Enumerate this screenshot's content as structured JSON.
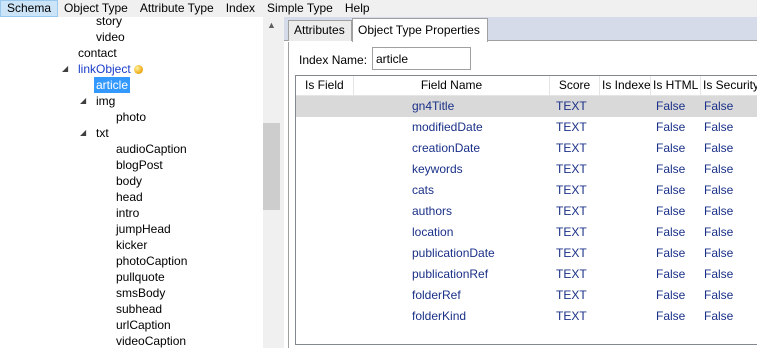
{
  "menu": [
    "Schema",
    "Object Type",
    "Attribute Type",
    "Index",
    "Simple Type",
    "Help"
  ],
  "tree": {
    "items": [
      {
        "label": "story",
        "level": 3,
        "toggle": "",
        "style": "normal"
      },
      {
        "label": "video",
        "level": 3,
        "toggle": "",
        "style": "normal"
      },
      {
        "label": "contact",
        "level": 2,
        "toggle": "",
        "style": "normal"
      },
      {
        "label": "linkObject",
        "level": 2,
        "toggle": "◢",
        "style": "blue",
        "badge": true
      },
      {
        "label": "article",
        "level": 3,
        "toggle": "",
        "style": "selected"
      },
      {
        "label": "img",
        "level": 3,
        "toggle": "◢",
        "style": "normal"
      },
      {
        "label": "photo",
        "level": 4,
        "toggle": "",
        "style": "normal"
      },
      {
        "label": "txt",
        "level": 3,
        "toggle": "◢",
        "style": "normal"
      },
      {
        "label": "audioCaption",
        "level": 4,
        "toggle": "",
        "style": "normal"
      },
      {
        "label": "blogPost",
        "level": 4,
        "toggle": "",
        "style": "normal"
      },
      {
        "label": "body",
        "level": 4,
        "toggle": "",
        "style": "normal"
      },
      {
        "label": "head",
        "level": 4,
        "toggle": "",
        "style": "normal"
      },
      {
        "label": "intro",
        "level": 4,
        "toggle": "",
        "style": "normal"
      },
      {
        "label": "jumpHead",
        "level": 4,
        "toggle": "",
        "style": "normal"
      },
      {
        "label": "kicker",
        "level": 4,
        "toggle": "",
        "style": "normal"
      },
      {
        "label": "photoCaption",
        "level": 4,
        "toggle": "",
        "style": "normal"
      },
      {
        "label": "pullquote",
        "level": 4,
        "toggle": "",
        "style": "normal"
      },
      {
        "label": "smsBody",
        "level": 4,
        "toggle": "",
        "style": "normal"
      },
      {
        "label": "subhead",
        "level": 4,
        "toggle": "",
        "style": "normal"
      },
      {
        "label": "urlCaption",
        "level": 4,
        "toggle": "",
        "style": "normal"
      },
      {
        "label": "videoCaption",
        "level": 4,
        "toggle": "",
        "style": "normal"
      }
    ]
  },
  "tabs": [
    {
      "label": "Attributes",
      "active": false
    },
    {
      "label": "Object Type Properties",
      "active": true
    }
  ],
  "index_name": {
    "label": "Index Name:",
    "value": "article"
  },
  "grid": {
    "columns": [
      "Is Field",
      "Field Name",
      "Score",
      "Is Indexed",
      "Is HTML",
      "Is Security"
    ],
    "rows": [
      {
        "is_field": "",
        "field_name": "gn4Title",
        "score": "TEXT",
        "indexed": "",
        "html": "False",
        "security": "False",
        "selected": true
      },
      {
        "is_field": "",
        "field_name": "modifiedDate",
        "score": "TEXT",
        "indexed": "",
        "html": "False",
        "security": "False"
      },
      {
        "is_field": "",
        "field_name": "creationDate",
        "score": "TEXT",
        "indexed": "",
        "html": "False",
        "security": "False"
      },
      {
        "is_field": "",
        "field_name": "keywords",
        "score": "TEXT",
        "indexed": "",
        "html": "False",
        "security": "False"
      },
      {
        "is_field": "",
        "field_name": "cats",
        "score": "TEXT",
        "indexed": "",
        "html": "False",
        "security": "False"
      },
      {
        "is_field": "",
        "field_name": "authors",
        "score": "TEXT",
        "indexed": "",
        "html": "False",
        "security": "False"
      },
      {
        "is_field": "",
        "field_name": "location",
        "score": "TEXT",
        "indexed": "",
        "html": "False",
        "security": "False"
      },
      {
        "is_field": "",
        "field_name": "publicationDate",
        "score": "TEXT",
        "indexed": "",
        "html": "False",
        "security": "False"
      },
      {
        "is_field": "",
        "field_name": "publicationRef",
        "score": "TEXT",
        "indexed": "",
        "html": "False",
        "security": "False"
      },
      {
        "is_field": "",
        "field_name": "folderRef",
        "score": "TEXT",
        "indexed": "",
        "html": "False",
        "security": "False"
      },
      {
        "is_field": "",
        "field_name": "folderKind",
        "score": "TEXT",
        "indexed": "",
        "html": "False",
        "security": "False"
      }
    ]
  },
  "colors": {
    "selection": "#3399ff",
    "link_blue": "#1a3cc8",
    "cell_text": "#1a3088",
    "selected_row": "#d9d9d9"
  }
}
